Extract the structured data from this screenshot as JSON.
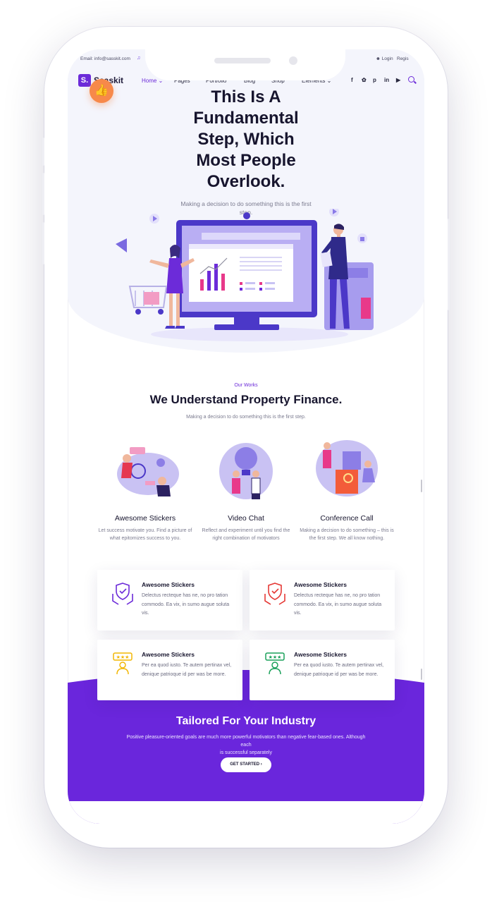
{
  "topbar": {
    "email": "Email: info@sasskit.com",
    "login": "Login",
    "register": "Regis"
  },
  "nav": {
    "logo_mark": "S.",
    "logo_text": "Saaskit",
    "items": [
      {
        "label": "Home ⌄"
      },
      {
        "label": "Pages"
      },
      {
        "label": "Portfolio"
      },
      {
        "label": "Blog"
      },
      {
        "label": "Shop"
      },
      {
        "label": "Elements ⌄"
      }
    ],
    "social_icons": [
      "facebook-icon",
      "twitter-icon",
      "pinterest-icon",
      "linkedin-icon",
      "youtube-icon"
    ]
  },
  "hero": {
    "title_lines": [
      "This Is A",
      "Fundamental",
      "Step, Which",
      "Most People",
      "Overlook."
    ],
    "subtitle_lines": [
      "Making a decision to do something this is the first",
      "step."
    ]
  },
  "works": {
    "tag": "Our Works",
    "title": "We Understand Property Finance.",
    "subtitle": "Making a decision to do something this is the first step.",
    "features": [
      {
        "title": "Awesome Stickers",
        "desc_lines": [
          "Let success motivate you. Find a picture of",
          "what epitomizes success to you."
        ]
      },
      {
        "title": "Video Chat",
        "desc_lines": [
          "Reflect and experiment until you find the",
          "right combination of motivators"
        ]
      },
      {
        "title": "Conference Call",
        "desc_lines": [
          "Making a decision to do something – this is",
          "the first step. We all know nothing."
        ]
      }
    ]
  },
  "cards": [
    {
      "title": "Awesome Stickers",
      "desc": "Delectus recteque has ne, no pro tation commodo. Ea vix, in sumo augue soluta vis.",
      "icon": "shield-hands-icon",
      "color": "#6c2bd9"
    },
    {
      "title": "Awesome Stickers",
      "desc": "Delectus recteque has ne, no pro tation commodo. Ea vix, in sumo augue soluta vis.",
      "icon": "shield-hands-icon",
      "color": "#e53935"
    },
    {
      "title": "Awesome Stickers",
      "desc": "Per ea quod iusto. Te autem pertinax vel, denique patrioque id per was be more.",
      "icon": "rating-person-icon",
      "color": "#f2b705"
    },
    {
      "title": "Awesome Stickers",
      "desc": "Per ea quod iusto. Te autem pertinax vel, denique patrioque id per was be more.",
      "icon": "rating-person-icon",
      "color": "#1aa05a"
    }
  ],
  "cta": {
    "title": "Tailored For Your Industry",
    "subtitle_lines": [
      "Positive pleasure-oriented goals are much more powerful motivators than negative fear-based ones. Although each",
      "is successful separately"
    ],
    "button": "GET STARTED ›"
  },
  "colors": {
    "brand": "#6c2bd9",
    "accent_orange": "#f7894a",
    "dark": "#17152e"
  }
}
